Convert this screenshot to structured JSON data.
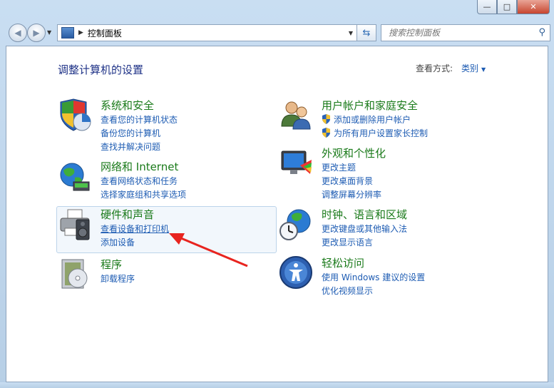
{
  "window": {
    "controls": {
      "minimize": "—",
      "maximize": "□",
      "close": "✕"
    }
  },
  "navbar": {
    "breadcrumb": "控制面板",
    "search_placeholder": "搜索控制面板"
  },
  "page": {
    "title": "调整计算机的设置",
    "view_label": "查看方式:",
    "view_value": "类别"
  },
  "categories": [
    {
      "title": "系统和安全",
      "links": [
        "查看您的计算机状态",
        "备份您的计算机",
        "查找并解决问题"
      ]
    },
    {
      "title": "网络和 Internet",
      "links": [
        "查看网络状态和任务",
        "选择家庭组和共享选项"
      ]
    },
    {
      "title": "硬件和声音",
      "links": [
        "查看设备和打印机",
        "添加设备"
      ]
    },
    {
      "title": "程序",
      "links": [
        "卸载程序"
      ]
    },
    {
      "title": "用户帐户和家庭安全",
      "links": [
        "添加或删除用户帐户",
        "为所有用户设置家长控制"
      ]
    },
    {
      "title": "外观和个性化",
      "links": [
        "更改主题",
        "更改桌面背景",
        "调整屏幕分辨率"
      ]
    },
    {
      "title": "时钟、语言和区域",
      "links": [
        "更改键盘或其他输入法",
        "更改显示语言"
      ]
    },
    {
      "title": "轻松访问",
      "links": [
        "使用 Windows 建议的设置",
        "优化视频显示"
      ]
    }
  ],
  "icons": {
    "back": "back-arrow-icon",
    "forward": "forward-arrow-icon",
    "refresh": "refresh-icon",
    "search": "search-icon",
    "annotation": "red-arrow-annotation"
  },
  "colors": {
    "title_green": "#1a7a1a",
    "link_blue": "#1e5cb3",
    "annotation_red": "#e8241f"
  }
}
